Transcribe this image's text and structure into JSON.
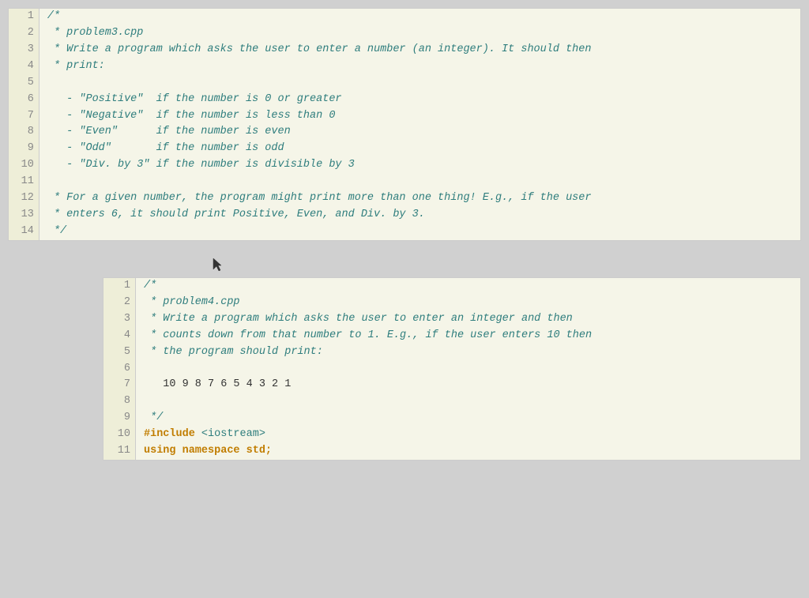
{
  "panel1": {
    "lines": [
      {
        "num": 1,
        "type": "comment",
        "text": "/*"
      },
      {
        "num": 2,
        "type": "comment",
        "text": " * problem3.cpp"
      },
      {
        "num": 3,
        "type": "comment",
        "text": " * Write a program which asks the user to enter a number (an integer). It should then"
      },
      {
        "num": 4,
        "type": "comment",
        "text": " * print:"
      },
      {
        "num": 5,
        "type": "comment",
        "text": ""
      },
      {
        "num": 6,
        "type": "comment",
        "text": "   - \"Positive\"  if the number is 0 or greater"
      },
      {
        "num": 7,
        "type": "comment",
        "text": "   - \"Negative\"  if the number is less than 0"
      },
      {
        "num": 8,
        "type": "comment",
        "text": "   - \"Even\"      if the number is even"
      },
      {
        "num": 9,
        "type": "comment",
        "text": "   - \"Odd\"       if the number is odd"
      },
      {
        "num": 10,
        "type": "comment",
        "text": "   - \"Div. by 3\" if the number is divisible by 3"
      },
      {
        "num": 11,
        "type": "comment",
        "text": ""
      },
      {
        "num": 12,
        "type": "comment",
        "text": " * For a given number, the program might print more than one thing! E.g., if the user"
      },
      {
        "num": 13,
        "type": "comment",
        "text": " * enters 6, it should print Positive, Even, and Div. by 3."
      },
      {
        "num": 14,
        "type": "comment",
        "text": " */"
      }
    ]
  },
  "panel2": {
    "lines": [
      {
        "num": 1,
        "type": "comment",
        "text": "/*"
      },
      {
        "num": 2,
        "type": "comment",
        "text": " * problem4.cpp"
      },
      {
        "num": 3,
        "type": "comment",
        "text": " * Write a program which asks the user to enter an integer and then"
      },
      {
        "num": 4,
        "type": "comment",
        "text": " * counts down from that number to 1. E.g., if the user enters 10 then"
      },
      {
        "num": 5,
        "type": "comment",
        "text": " * the program should print:"
      },
      {
        "num": 6,
        "type": "comment",
        "text": ""
      },
      {
        "num": 7,
        "type": "normal",
        "text": "   10 9 8 7 6 5 4 3 2 1"
      },
      {
        "num": 8,
        "type": "comment",
        "text": ""
      },
      {
        "num": 9,
        "type": "comment",
        "text": " */"
      },
      {
        "num": 10,
        "type": "include",
        "text": "#include <iostream>"
      },
      {
        "num": 11,
        "type": "using",
        "text": "using namespace std;"
      }
    ]
  }
}
